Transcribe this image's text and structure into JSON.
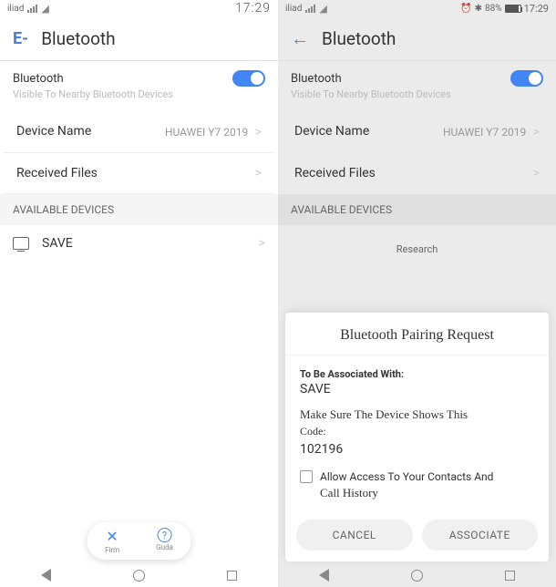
{
  "left": {
    "status": {
      "carrier": "iliad",
      "time": "17:29"
    },
    "header": {
      "back": "E-",
      "title": "Bluetooth"
    },
    "bluetooth": {
      "label": "Bluetooth",
      "subtitle": "Visible To Nearby Bluetooth Devices"
    },
    "device_name": {
      "label": "Device Name",
      "value": "HUAWEI Y7 2019"
    },
    "received": {
      "label": "Received Files"
    },
    "section": "AVAILABLE DEVICES",
    "device": {
      "name": "SAVE"
    },
    "pill": {
      "firm": "Firm",
      "guda": "Guda"
    }
  },
  "right": {
    "status": {
      "carrier": "iliad",
      "battery": "88%",
      "time": "17:29"
    },
    "header": {
      "title": "Bluetooth"
    },
    "bluetooth": {
      "label": "Bluetooth",
      "subtitle": "Visible To Nearby Bluetooth Devices"
    },
    "device_name": {
      "label": "Device Name",
      "value": "HUAWEI Y7 2019"
    },
    "received": {
      "label": "Received Files"
    },
    "section": "AVAILABLE DEVICES",
    "research": "Research",
    "dialog": {
      "title": "Bluetooth Pairing Request",
      "assoc_label": "To Be Associated With:",
      "device": "SAVE",
      "msg": "Make Sure The Device Shows This",
      "code_label": "Code:",
      "code": "102196",
      "check1": "Allow Access To Your Contacts And",
      "check2": "Call History",
      "cancel": "CANCEL",
      "associate": "ASSOCIATE"
    }
  }
}
